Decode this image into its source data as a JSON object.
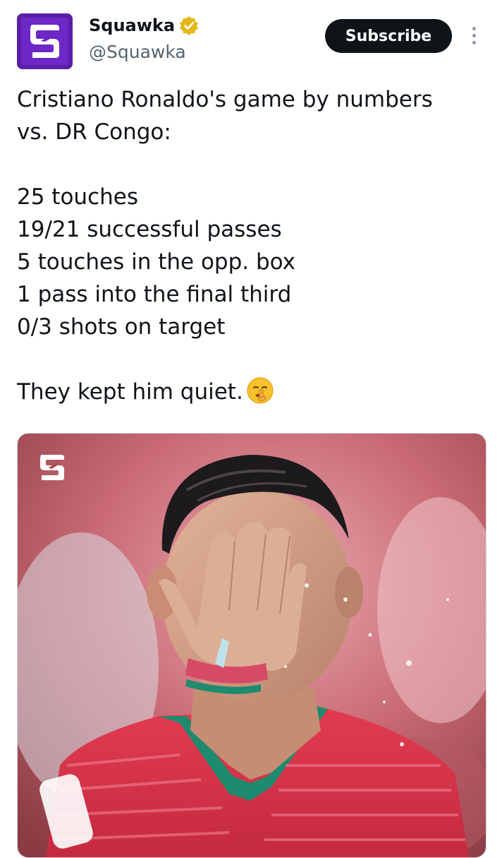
{
  "account": {
    "name": "Squawka",
    "handle": "@Squawka",
    "verified_icon": "verified-badge-gold",
    "avatar_color": "#5a1fa8"
  },
  "actions": {
    "subscribe_label": "Subscribe",
    "more_icon": "more-vertical-icon"
  },
  "tweet": {
    "lines": [
      "Cristiano Ronaldo's game by numbers",
      "vs. DR Congo:",
      "25 touches",
      "19/21 successful passes",
      "5 touches in the opp. box",
      "1 pass into the final third",
      "0/3 shots on target",
      "They kept him quiet."
    ],
    "emoji": "shushing-face-emoji"
  },
  "media": {
    "type": "photo",
    "watermark_icon": "squawka-logo-watermark"
  },
  "colors": {
    "subscribe_bg": "#0f1419",
    "handle": "#536471",
    "jersey": "#d9304a"
  }
}
